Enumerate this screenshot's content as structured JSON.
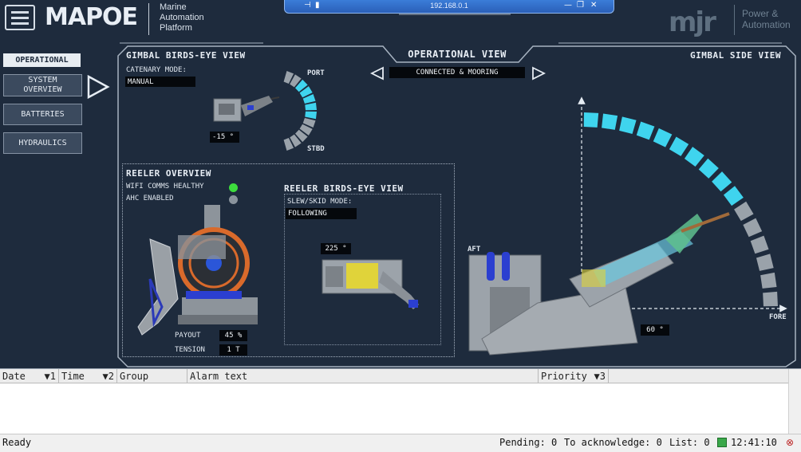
{
  "header": {
    "logo": "MAPOE",
    "logo_subtitle": "Marine\nAutomation\nPlatform",
    "remote_ip": "192.168.0.1",
    "brand_logo": "mjr",
    "brand_subtitle": "Power &\nAutomation"
  },
  "nav": {
    "operational": "OPERATIONAL",
    "items": [
      {
        "label": "SYSTEM\nOVERVIEW"
      },
      {
        "label": "BATTERIES"
      },
      {
        "label": "HYDRAULICS"
      }
    ]
  },
  "operational_view": {
    "title": "OPERATIONAL VIEW",
    "mode": "CONNECTED & MOORING"
  },
  "gimbal_birdseye": {
    "title": "GIMBAL BIRDS-EYE VIEW",
    "catenary_label": "CATENARY MODE:",
    "catenary_value": "MANUAL",
    "angle": "-15 °",
    "port_label": "PORT",
    "stbd_label": "STBD",
    "gauge_segments": 12,
    "gauge_active": [
      2,
      3,
      4,
      5,
      6
    ]
  },
  "reeler_overview": {
    "title": "REELER OVERVIEW",
    "wifi_label": "WIFI COMMS HEALTHY",
    "ahc_label": "AHC ENABLED",
    "wifi_status_color": "#3ddc3d",
    "ahc_status_color": "#8a939c",
    "payout_label": "PAYOUT",
    "payout_value": "45 %",
    "tension_label": "TENSION",
    "tension_value": "1 T"
  },
  "reeler_birdseye": {
    "title": "REELER BIRDS-EYE VIEW",
    "slew_label": "SLEW/SKID MODE:",
    "slew_value": "FOLLOWING",
    "angle": "225 °"
  },
  "gimbal_side": {
    "title": "GIMBAL SIDE VIEW",
    "aft_label": "AFT",
    "fore_label": "FORE",
    "angle": "60 °",
    "gauge_segments": 16,
    "gauge_active_count": 10
  },
  "alarms": {
    "columns": [
      "Date",
      "Time",
      "Group",
      "Alarm text",
      "Priority"
    ],
    "date_sort": "▼1",
    "time_sort": "▼2",
    "priority_sort": "▼3",
    "rows": []
  },
  "status": {
    "ready": "Ready",
    "pending": "Pending: 0",
    "to_ack": "To acknowledge: 0",
    "list": "List: 0",
    "clock": "12:41:10"
  },
  "colors": {
    "background": "#1e2b3d",
    "accent_cyan": "#3fd4ee",
    "gauge_inactive": "#9aa2aa",
    "panel_border": "#a7b3c1"
  }
}
